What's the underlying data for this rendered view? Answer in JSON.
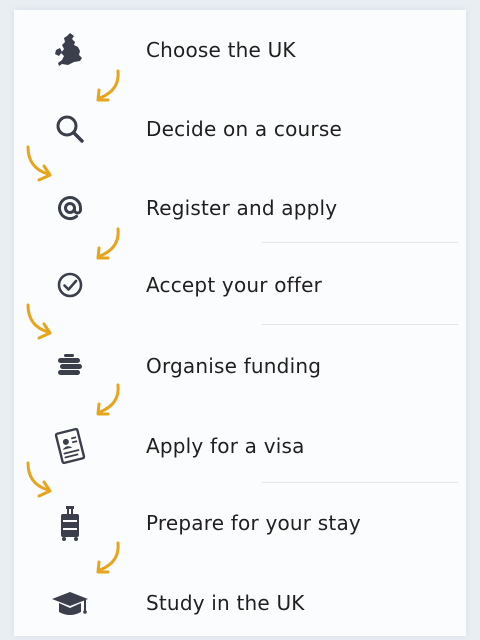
{
  "steps": [
    {
      "label": "Choose the UK",
      "icon": "uk-map-icon"
    },
    {
      "label": "Decide on a course",
      "icon": "search-icon"
    },
    {
      "label": "Register and apply",
      "icon": "at-sign-icon"
    },
    {
      "label": "Accept your offer",
      "icon": "check-circle-icon"
    },
    {
      "label": "Organise funding",
      "icon": "coin-stack-icon"
    },
    {
      "label": "Apply for a visa",
      "icon": "visa-document-icon"
    },
    {
      "label": "Prepare for your stay",
      "icon": "luggage-icon"
    },
    {
      "label": "Study in the UK",
      "icon": "graduation-cap-icon"
    }
  ],
  "colors": {
    "arrow": "#e7a51d",
    "icon": "#3a3f4b",
    "text": "#1f1f1f",
    "background": "#fbfcfd"
  }
}
